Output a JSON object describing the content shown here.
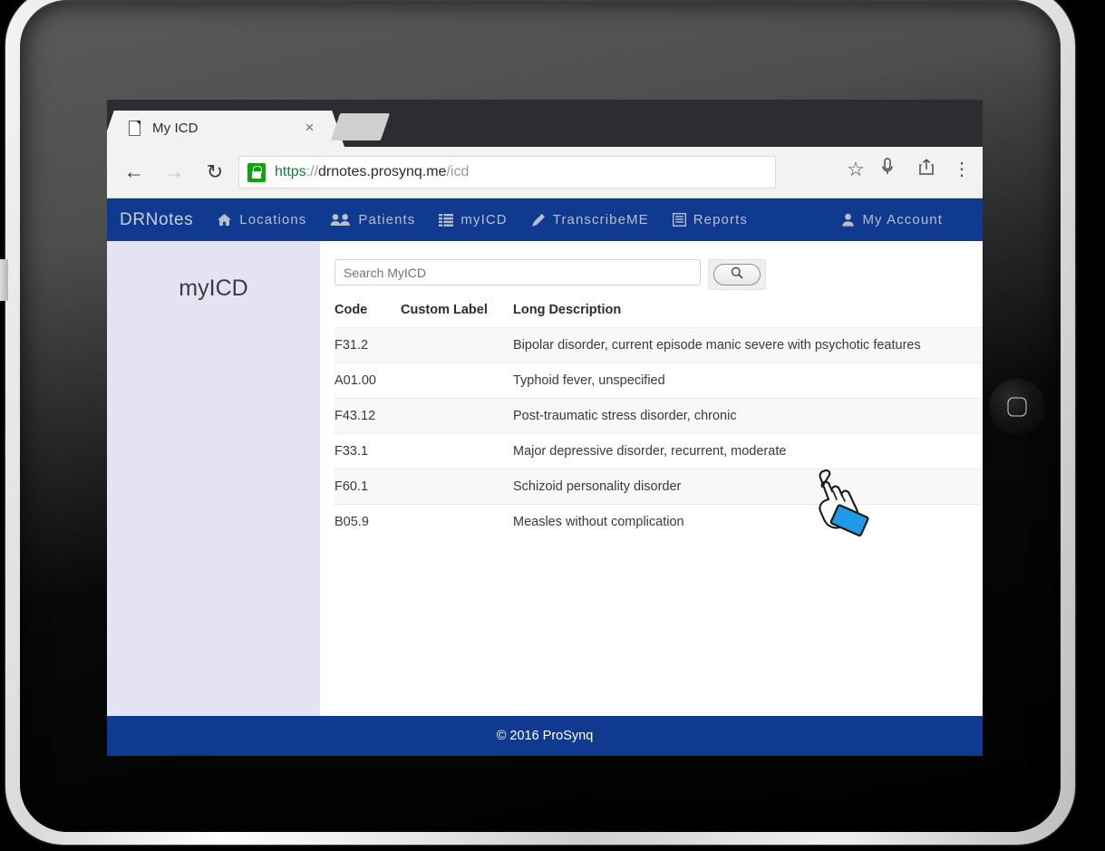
{
  "browser": {
    "tab": {
      "title": "My ICD",
      "favicon": "page-icon",
      "close": "×"
    },
    "new_tab_label": "",
    "nav": {
      "back": "←",
      "forward": "→",
      "reload": "↻"
    },
    "omnibox": {
      "secure_icon": "lock-icon",
      "scheme": "https",
      "separator": "://",
      "host": "drnotes.prosynq.me",
      "path": "/icd"
    },
    "tools": {
      "star": "☆",
      "mic": "mic-icon",
      "share": "share-icon",
      "menu": "⋮"
    }
  },
  "appnav": {
    "brand": "DRNotes",
    "items": [
      {
        "label": "Locations",
        "icon": "home-icon"
      },
      {
        "label": "Patients",
        "icon": "users-icon"
      },
      {
        "label": "myICD",
        "icon": "list-icon"
      },
      {
        "label": "TranscribeME",
        "icon": "pencil-icon"
      },
      {
        "label": "Reports",
        "icon": "report-icon"
      }
    ],
    "account": {
      "label": "My Account",
      "icon": "user-icon"
    }
  },
  "sidebar": {
    "title": "myICD"
  },
  "search": {
    "placeholder": "Search MyICD",
    "value": "",
    "button_icon": "magnifier-icon"
  },
  "table": {
    "headers": [
      "Code",
      "Custom Label",
      "Long Description"
    ],
    "rows": [
      {
        "code": "F31.2",
        "custom_label": "",
        "description": "Bipolar disorder, current episode manic severe with psychotic features"
      },
      {
        "code": "A01.00",
        "custom_label": "",
        "description": "Typhoid fever, unspecified"
      },
      {
        "code": "F43.12",
        "custom_label": "",
        "description": "Post-traumatic stress disorder, chronic"
      },
      {
        "code": "F33.1",
        "custom_label": "",
        "description": "Major depressive disorder, recurrent, moderate"
      },
      {
        "code": "F60.1",
        "custom_label": "",
        "description": "Schizoid personality disorder"
      },
      {
        "code": "B05.9",
        "custom_label": "",
        "description": "Measles without complication"
      }
    ]
  },
  "footer": {
    "text": "© 2016 ProSynq"
  },
  "device": {
    "home_button": "home-button"
  },
  "cursor": {
    "type": "pointing-hand-cursor"
  },
  "colors": {
    "nav_blue": "#0f3a8f",
    "sidebar_lavender": "#e3e3f4",
    "row_stripe": "#f8f8f8",
    "lock_green": "#0ba60b",
    "cursor_cuff_blue": "#1e9ae8"
  }
}
